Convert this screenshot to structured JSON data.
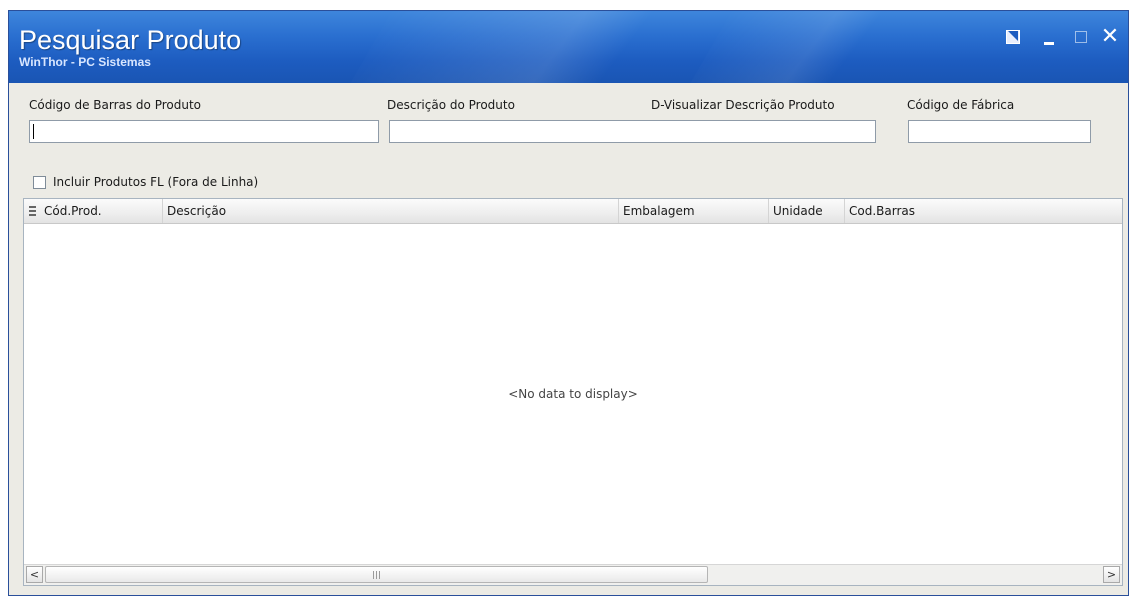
{
  "window": {
    "title": "Pesquisar Produto",
    "subtitle": "WinThor - PC Sistemas",
    "close_glyph": "✕",
    "buttons": [
      "restore-icon",
      "minimize-icon",
      "maximize-icon",
      "close-icon"
    ]
  },
  "filters": {
    "barcode_label": "Código de Barras do Produto",
    "barcode_value": "",
    "description_label": "Descrição do Produto",
    "description_value": "",
    "view_description_label": "D-Visualizar Descrição Produto",
    "factory_code_label": "Código de Fábrica",
    "factory_code_value": "",
    "include_fl_label": "Incluir Produtos FL (Fora de Linha)",
    "include_fl_checked": false
  },
  "grid": {
    "columns": [
      "Cód.Prod.",
      "Descrição",
      "Embalagem",
      "Unidade",
      "Cod.Barras"
    ],
    "rows": [],
    "empty_text": "<No data to display>",
    "scroll_left": "<",
    "scroll_right": ">"
  },
  "colors": {
    "titlebar": "#1d5cc0",
    "window_bg": "#ecebe5",
    "grid_bg": "#ffffff"
  }
}
